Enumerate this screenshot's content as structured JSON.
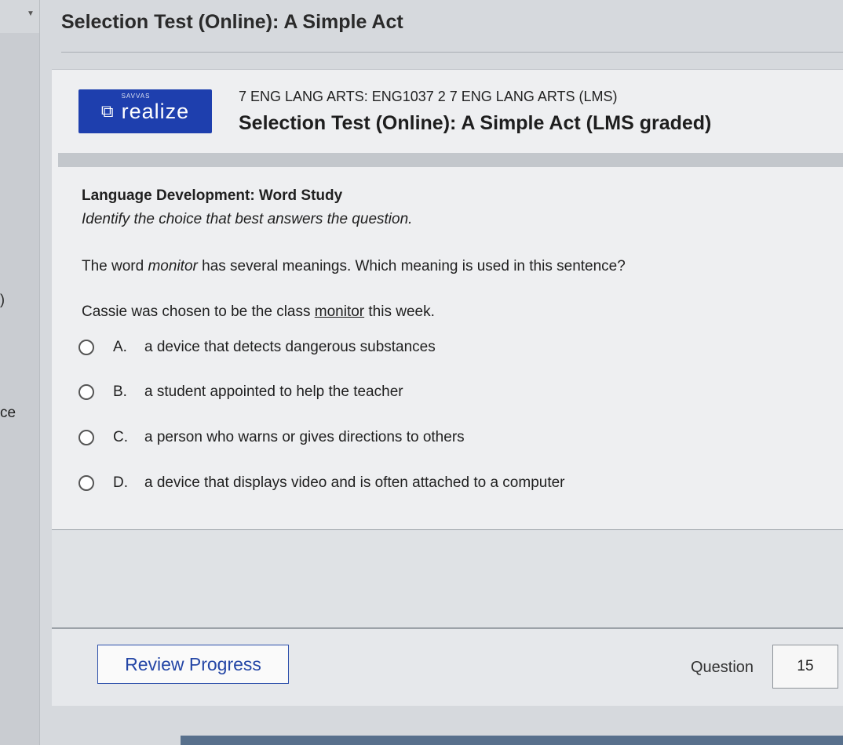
{
  "header": {
    "title": "Selection Test (Online): A Simple Act"
  },
  "sidebar": {
    "paren": ")",
    "cut_text": "ce"
  },
  "logo": {
    "brand_small": "SAVVAS",
    "brand_word": "realize"
  },
  "course": {
    "line": "7 ENG LANG ARTS: ENG1037 2 7 ENG LANG ARTS (LMS)",
    "assignment_title": "Selection Test (Online): A Simple Act (LMS graded)"
  },
  "question": {
    "section_title": "Language Development: Word Study",
    "directions": "Identify the choice that best answers the question.",
    "prompt_before": "The word ",
    "prompt_term": "monitor",
    "prompt_after": " has several meanings. Which meaning is used in this sentence?",
    "sentence_before": "Cassie was chosen to be the class ",
    "sentence_term": "monitor",
    "sentence_after": " this week.",
    "options": [
      {
        "letter": "A.",
        "text": "a device that detects dangerous substances"
      },
      {
        "letter": "B.",
        "text": "a student appointed to help the teacher"
      },
      {
        "letter": "C.",
        "text": "a person who warns or gives directions to others"
      },
      {
        "letter": "D.",
        "text": "a device that displays video and is often attached to a computer"
      }
    ]
  },
  "footer": {
    "review_label": "Review Progress",
    "question_label": "Question",
    "question_number": "15"
  }
}
